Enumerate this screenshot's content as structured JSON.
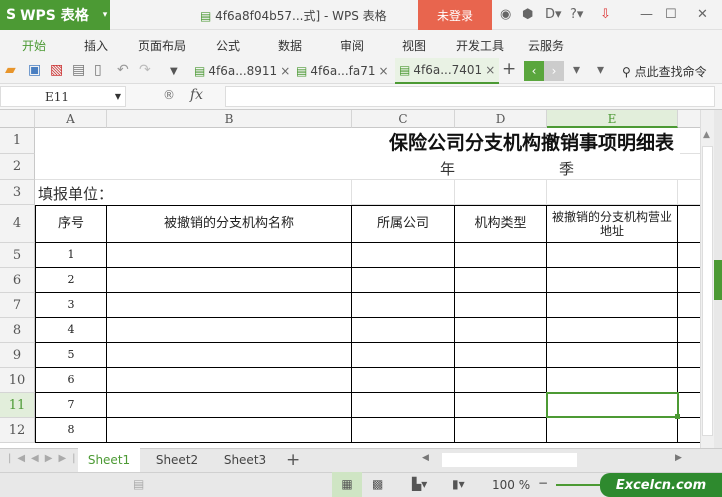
{
  "app": {
    "name": "WPS 表格",
    "window_title": "4f6a8f04b57...式] - WPS 表格",
    "login": "未登录"
  },
  "menu": [
    "开始",
    "插入",
    "页面布局",
    "公式",
    "数据",
    "审阅",
    "视图",
    "开发工具",
    "云服务"
  ],
  "doc_tabs": [
    {
      "label": "4f6a...8911"
    },
    {
      "label": "4f6a...fa71"
    },
    {
      "label": "4f6a...7401"
    }
  ],
  "search_cmd": "点此查找命令",
  "formula": {
    "name_box": "E11",
    "fx": "fx",
    "value": ""
  },
  "columns": [
    "A",
    "B",
    "C",
    "D",
    "E"
  ],
  "rows": [
    "1",
    "2",
    "3",
    "4",
    "5",
    "6",
    "7",
    "8",
    "9",
    "10",
    "11",
    "12"
  ],
  "sheet": {
    "title": "保险公司分支机构撤销事项明细表",
    "year": "年",
    "quarter": "季",
    "unit_label": "填报单位：",
    "headers": [
      "序号",
      "被撤销的分支机构名称",
      "所属公司",
      "机构类型",
      "被撤销的分支机构营业地址"
    ],
    "serials": [
      "1",
      "2",
      "3",
      "4",
      "5",
      "6",
      "7",
      "8"
    ]
  },
  "sheet_tabs": [
    "Sheet1",
    "Sheet2",
    "Sheet3"
  ],
  "status": {
    "zoom": "100 %",
    "brand": "Excelcn.com"
  },
  "colors": {
    "accent": "#4c9a34",
    "login": "#e8654e"
  }
}
